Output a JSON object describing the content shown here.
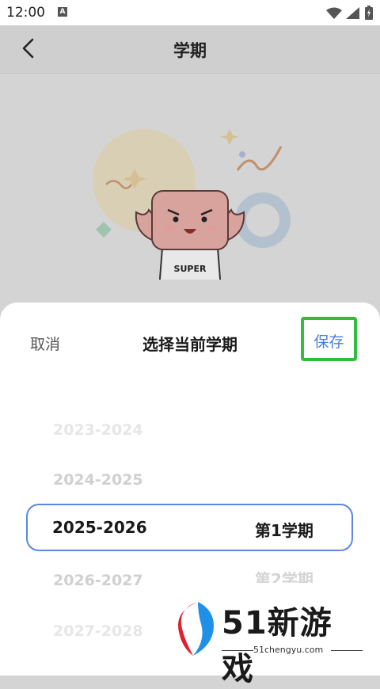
{
  "status_bar": {
    "time": "12:00",
    "a_badge": "A"
  },
  "app_bar": {
    "title": "学期"
  },
  "mascot": {
    "shirt_text": "SUPER"
  },
  "sheet": {
    "cancel_label": "取消",
    "title": "选择当前学期",
    "save_label": "保存"
  },
  "picker": {
    "years": [
      "2023-2024",
      "2024-2025",
      "2025-2026",
      "2026-2027",
      "2027-2028"
    ],
    "selected_year": "2025-2026",
    "selected_term": "第1学期",
    "next_term": "第2学期"
  },
  "watermark": {
    "brand": "51新游戏",
    "url": "51chengyu.com"
  },
  "colors": {
    "accent": "#4a7fe0",
    "highlight_box": "#2fbe3d",
    "selection_border": "#5b87e0"
  }
}
